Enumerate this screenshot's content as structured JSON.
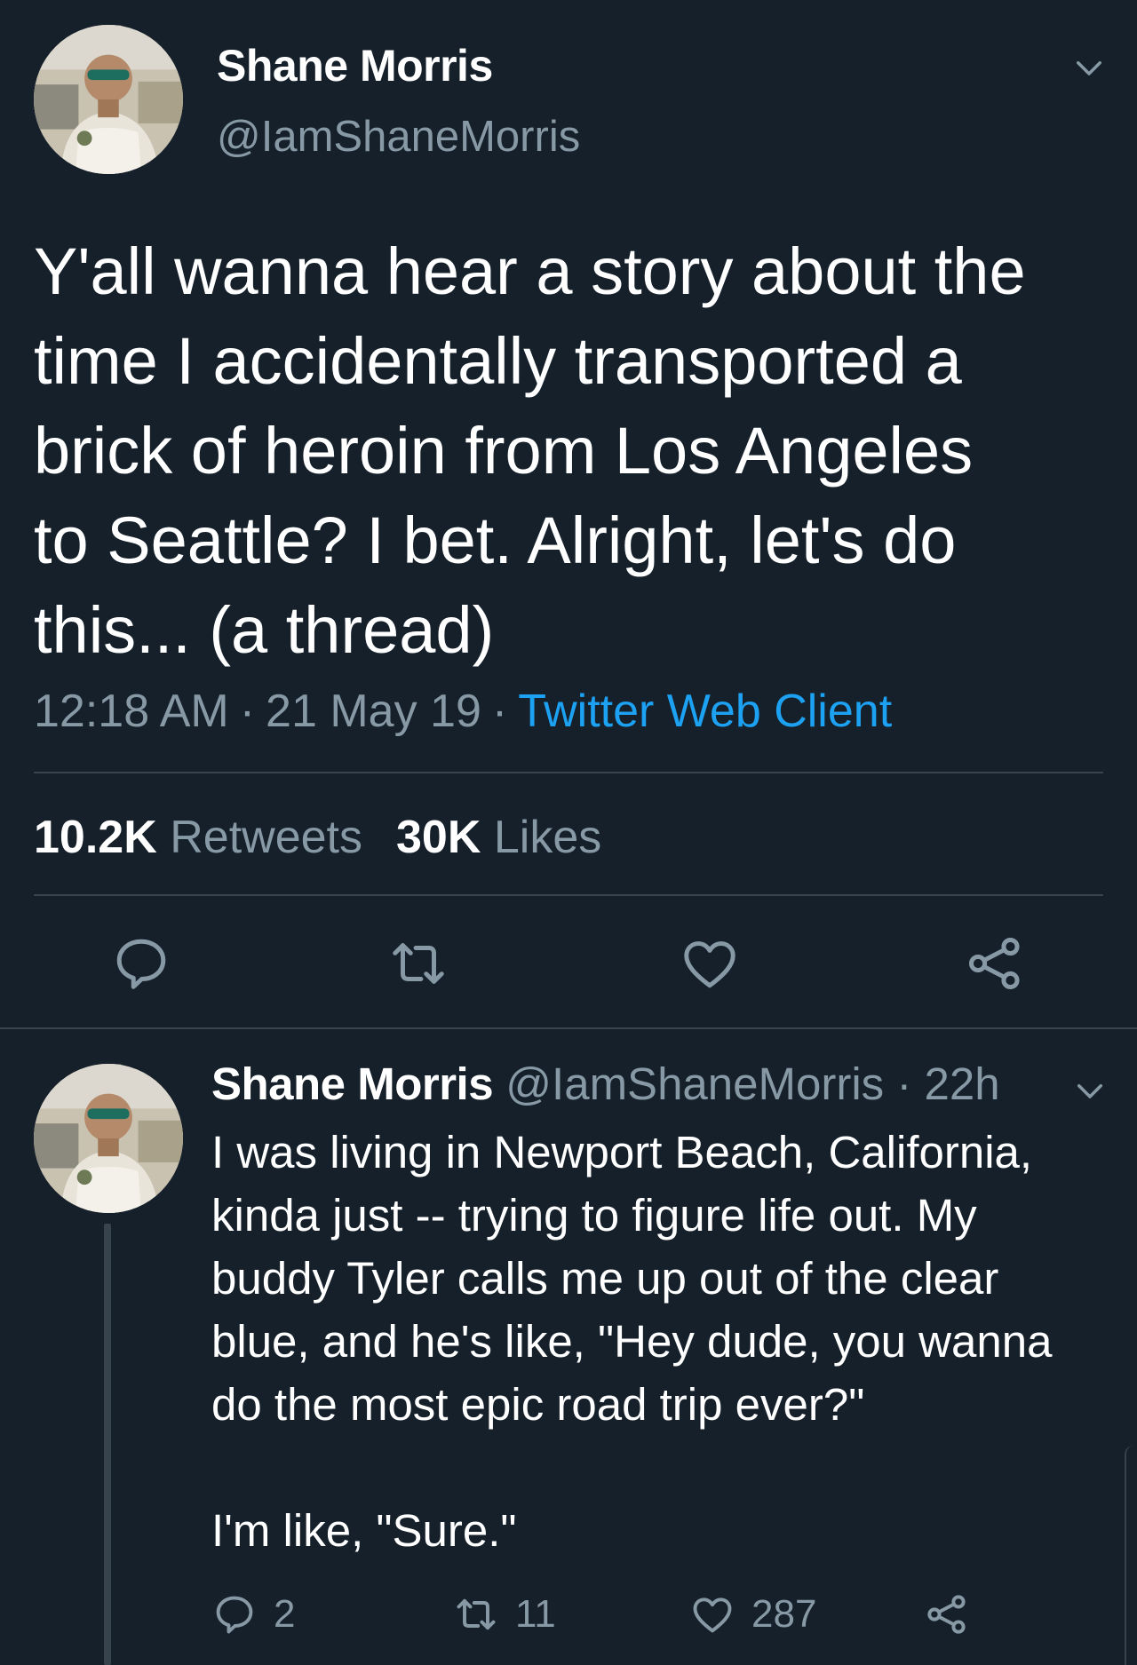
{
  "main_tweet": {
    "author_name": "Shane Morris",
    "author_handle": "@IamShaneMorris",
    "text": "Y'all wanna hear a story about the\ntime I accidentally transported a\nbrick of heroin from Los Angeles\nto Seattle? I bet. Alright, let's do\nthis... (a thread)",
    "time": "12:18 AM",
    "date": "21 May 19",
    "separator": "·",
    "client": "Twitter Web Client",
    "retweets_count": "10.2K",
    "retweets_label": "Retweets",
    "likes_count": "30K",
    "likes_label": "Likes",
    "icons": [
      "chevron-down-icon",
      "reply-icon",
      "retweet-icon",
      "like-icon",
      "share-icon"
    ]
  },
  "reply_tweet": {
    "author_name": "Shane Morris",
    "author_handle": "@IamShaneMorris",
    "separator": "·",
    "age": "22h",
    "text": "I was living in Newport Beach, California,\nkinda just -- trying to figure life out. My\nbuddy Tyler calls me up out of the clear\nblue, and he's like, \"Hey dude, you wanna\ndo the most epic road trip ever?\"\n\nI'm like, \"Sure.\"",
    "reply_count": "2",
    "retweet_count": "11",
    "like_count": "287"
  },
  "colors": {
    "background": "#15202b",
    "primary_text": "#ffffff",
    "secondary_text": "#8899a6",
    "link": "#1da1f2",
    "divider": "#38444d"
  }
}
